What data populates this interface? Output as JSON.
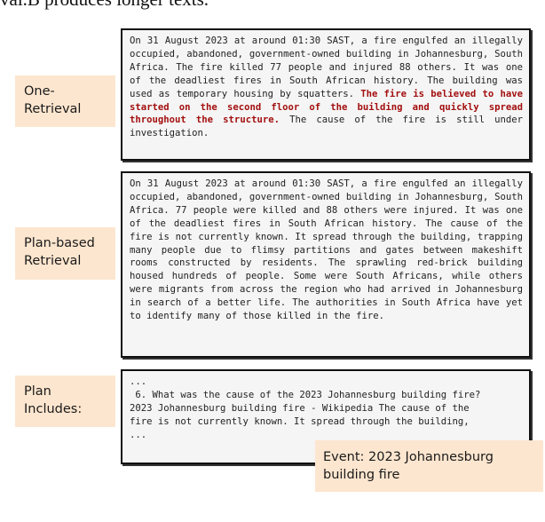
{
  "caption_fragment": "val.B produces longer texts.",
  "panels": [
    {
      "label": "One-Retrieval",
      "text_before": "On 31 August 2023 at around 01:30 SAST, a fire engulfed an illegally occupied, abandoned, government-owned building in Johannesburg, South Africa. The fire killed 77 people and injured 88 others. It was one of the deadliest fires in South African history. The building was used as temporary housing by squatters. ",
      "highlight": "The fire is believed to have started on the second floor of the building and quickly spread throughout the structure.",
      "text_after": " The cause of the fire is still under investigation.",
      "highlight_color": "#a30f0f"
    },
    {
      "label": "Plan-based Retrieval",
      "text": "On 31 August 2023 at around 01:30 SAST, a fire engulfed an illegally occupied, abandoned, government-owned building in Johannesburg, South Africa. 77 people were killed and 88 others were injured. It was one of the deadliest fires in South African history. The cause of the fire is not currently known. It spread through the building, trapping many people due to flimsy partitions and gates between makeshift rooms constructed by residents. The sprawling red-brick building housed hundreds of people. Some were South Africans, while others were migrants from across the region who had arrived in Johannesburg in search of a better life. The authorities in South Africa have yet to identify many of those killed in the fire."
    },
    {
      "label": "Plan Includes:",
      "lines": [
        "...",
        " 6. What was the cause of the 2023 Johannesburg building fire?",
        "2023 Johannesburg building fire - Wikipedia The cause of the",
        "fire is not currently known. It spread through the building,",
        "..."
      ]
    }
  ],
  "event_label": "Event: 2023 Johannesburg building fire",
  "label_bg_color": "#fde6cf"
}
